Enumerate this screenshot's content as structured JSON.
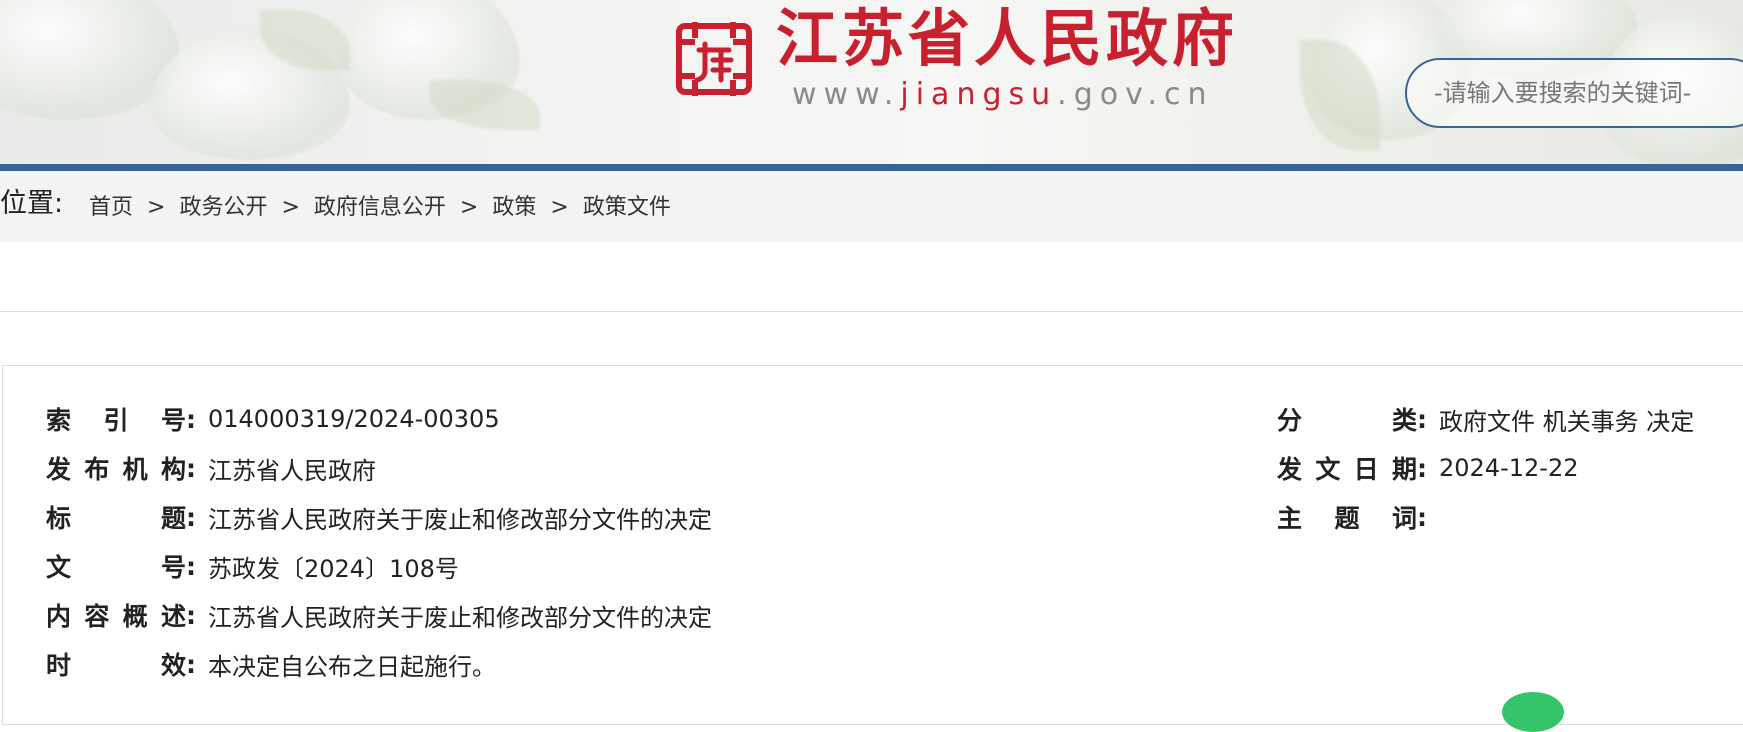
{
  "header": {
    "site_title": "江苏省人民政府",
    "site_url_prefix": "www.",
    "site_url_highlight": "jiangsu",
    "site_url_suffix": ".gov.cn",
    "logo_icon": "jiangsu-gov-emblem",
    "search_placeholder": "-请输入要搜索的关键词-"
  },
  "breadcrumb": {
    "label": "位置:",
    "items": [
      "首页",
      "政务公开",
      "政府信息公开",
      "政策",
      "政策文件"
    ],
    "separator": ">"
  },
  "info": {
    "left": [
      {
        "label": "索引号",
        "value": "014000319/2024-00305"
      },
      {
        "label": "发布机构",
        "value": "江苏省人民政府"
      },
      {
        "label": "标题",
        "value": "江苏省人民政府关于废止和修改部分文件的决定"
      },
      {
        "label": "文号",
        "value": "苏政发〔2024〕108号"
      },
      {
        "label": "内容概述",
        "value": "江苏省人民政府关于废止和修改部分文件的决定"
      },
      {
        "label": "时效",
        "value": "本决定自公布之日起施行。"
      }
    ],
    "right": [
      {
        "label": "分类",
        "value": "政府文件 机关事务 决定"
      },
      {
        "label": "发文日期",
        "value": "2024-12-22"
      },
      {
        "label": "主题词",
        "value": ""
      }
    ],
    "colon": ":"
  },
  "colors": {
    "brand_red": "#c8202e",
    "header_bar": "#3a6495",
    "breadcrumb_bg": "#f3f3f3"
  }
}
